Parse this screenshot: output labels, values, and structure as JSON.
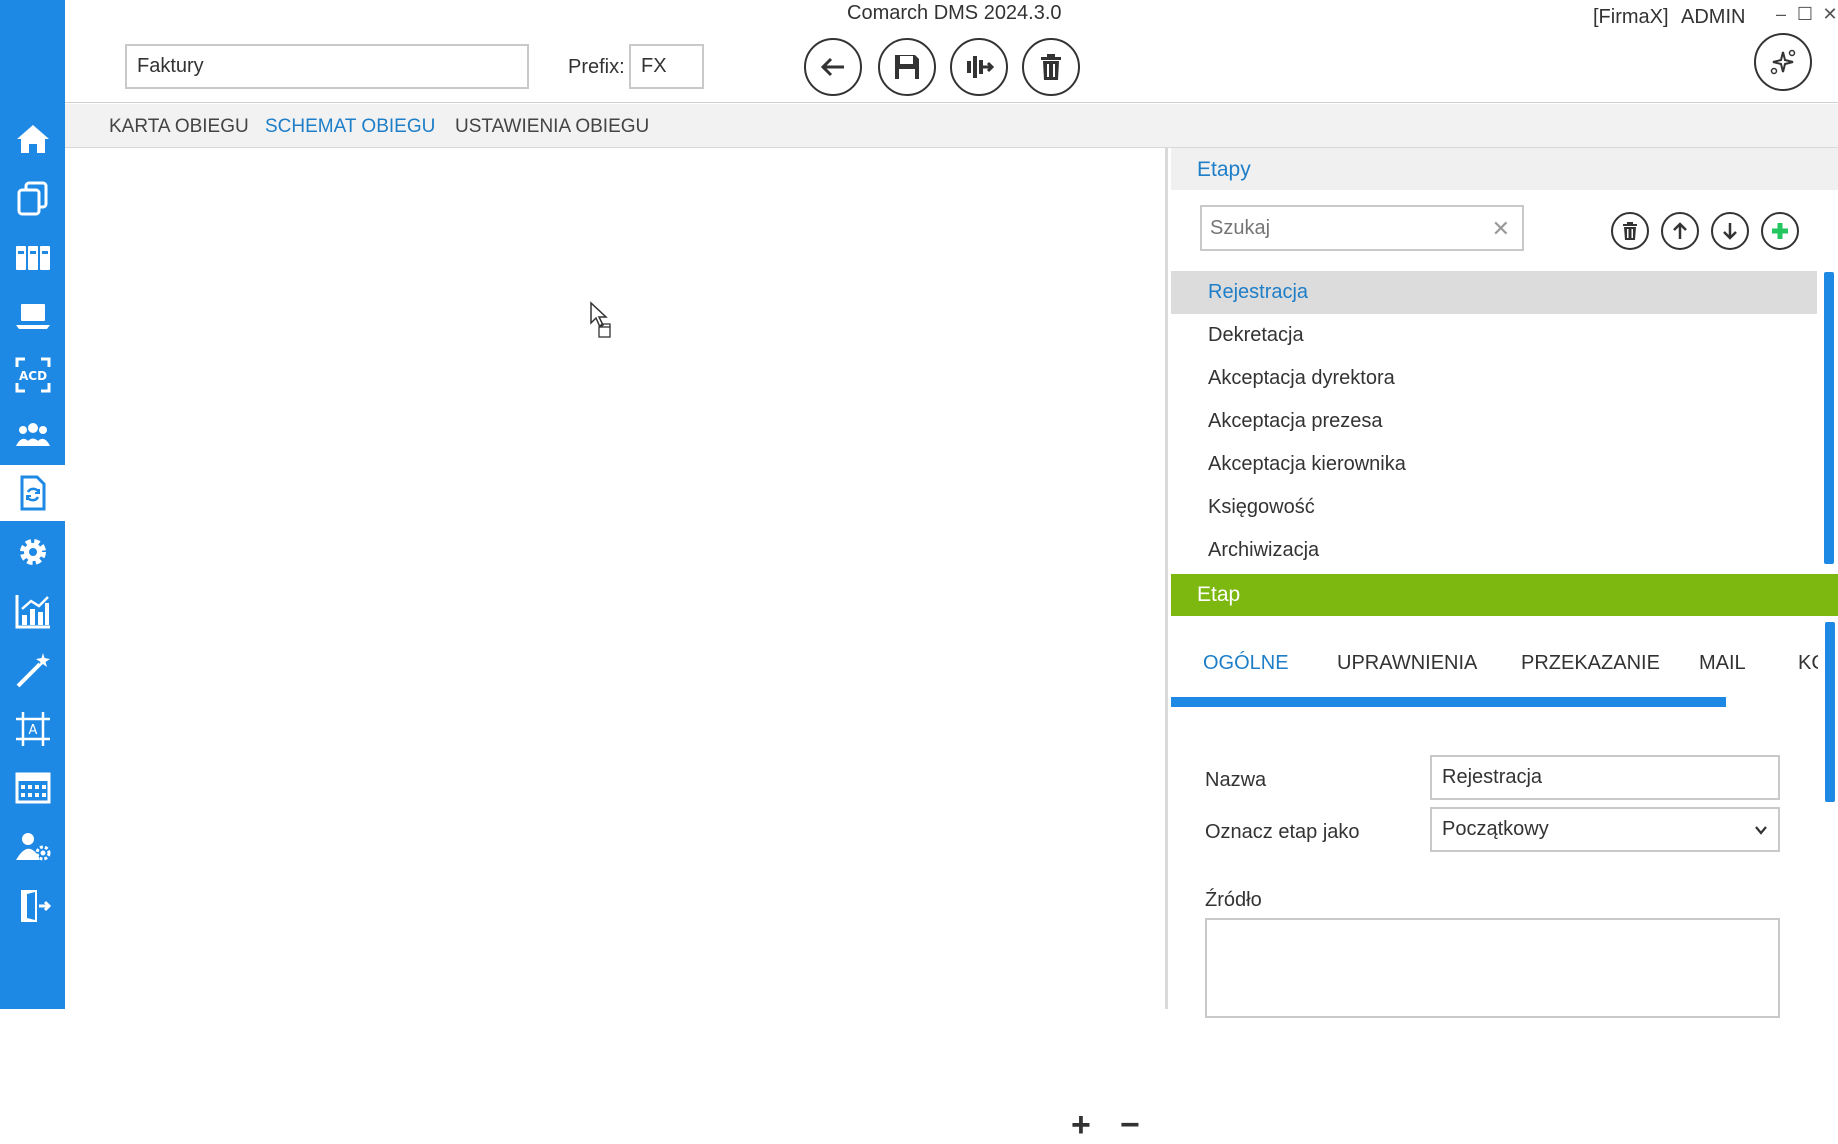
{
  "window": {
    "title": "Comarch DMS 2024.3.0",
    "company": "[FirmaX]",
    "user": "ADMIN",
    "controls": [
      "–",
      "☐",
      "✕"
    ]
  },
  "header": {
    "name_value": "Faktury",
    "prefix_label": "Prefix:",
    "prefix_value": "FX",
    "buttons": [
      "back-icon",
      "save-icon",
      "workflow-icon",
      "delete-icon"
    ],
    "ai_button": "sparkle-icon"
  },
  "sidebar": {
    "accent": "#1e88e5",
    "items": [
      "home-icon",
      "documents-icon",
      "binders-icon",
      "laptop-icon",
      "ocr-icon",
      "users-icon",
      "workflow-doc-icon",
      "settings-icon",
      "reports-icon",
      "wand-icon",
      "template-icon",
      "calendar-icon",
      "user-settings-icon",
      "logout-icon"
    ],
    "active_index": 6
  },
  "tabs": {
    "items": [
      "KARTA OBIEGU",
      "SCHEMAT OBIEGU",
      "USTAWIENIA OBIEGU"
    ],
    "active_index": 1
  },
  "canvas": {
    "zoom_in": "+",
    "zoom_out": "−"
  },
  "etapy": {
    "title": "Etapy",
    "search_placeholder": "Szukaj",
    "search_clear": "✕",
    "toolbar": [
      "trash-icon",
      "arrow-up-icon",
      "arrow-down-icon",
      "plus-icon"
    ],
    "items": [
      "Rejestracja",
      "Dekretacja",
      "Akceptacja dyrektora",
      "Akceptacja prezesa",
      "Akceptacja kierownika",
      "Księgowość",
      "Archiwizacja"
    ],
    "selected_index": 0
  },
  "etap": {
    "title": "Etap",
    "header_color": "#7cb80f",
    "tabs": [
      "OGÓLNE",
      "UPRAWNIENIA",
      "PRZEKAZANIE",
      "MAIL",
      "KC"
    ],
    "active_tab": 0,
    "fields": {
      "name_label": "Nazwa",
      "name_value": "Rejestracja",
      "mark_label": "Oznacz etap jako",
      "mark_value": "Początkowy",
      "source_label": "Źródło",
      "source_value": ""
    }
  }
}
